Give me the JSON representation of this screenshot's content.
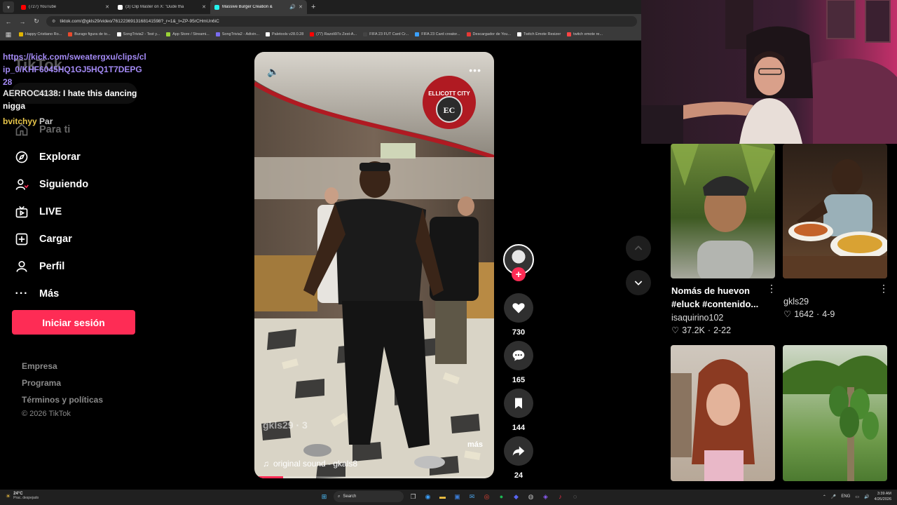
{
  "browser": {
    "tabs": [
      {
        "label": "(727) YouTube",
        "color": "#ff0000",
        "active": false
      },
      {
        "label": "(3) Clip Master on X: \"Dude tha",
        "color": "#ffffff",
        "active": false
      },
      {
        "label": "Massive Burger Creation &",
        "color": "#25f4ee",
        "active": true
      }
    ],
    "new_tab": "+",
    "url": "tiktok.com/@gkls29/video/7612236913168141598?_r=1&_t=ZP-95rCHmUn6iC",
    "bookmarks": [
      {
        "label": "Happy Cristiano Ro...",
        "color": "#e0b400"
      },
      {
        "label": "Burago figura de to...",
        "color": "#e84a2c"
      },
      {
        "label": "SongTrivia2 - Test y...",
        "color": "#ffffff"
      },
      {
        "label": "App Store / Streami...",
        "color": "#9ad336"
      },
      {
        "label": "SongTrivia2 - Adivin...",
        "color": "#7a6cf0"
      },
      {
        "label": "Paletools v28.0.28",
        "color": "#ffffff"
      },
      {
        "label": "(77) Razoli97s Zest-A...",
        "color": "#ff0000"
      },
      {
        "label": "FIFA 23 FUT Card Cr...",
        "color": "#444444"
      },
      {
        "label": "FIFA 23 Card creator...",
        "color": "#3aa0ff"
      },
      {
        "label": "Descargador de You...",
        "color": "#e53935"
      },
      {
        "label": "Twitch Emote Resizer",
        "color": "#ffffff"
      },
      {
        "label": "twitch emote re...",
        "color": "#ff4444"
      }
    ]
  },
  "chat": {
    "link": "https://kick.com/sweatergxu/clips/clip_0/KHF6045HQ1GJ5HQ1T7DEPG28",
    "user1": "AERROC4138",
    "msg1": ": I hate this dancing nigga",
    "user2": "bvitchyy",
    "msg2": "Par"
  },
  "tiktok": {
    "logo": "TikTok",
    "search_placeholder": "Buscar",
    "nav": [
      {
        "label": "Para ti",
        "icon": "home-icon",
        "faded": true
      },
      {
        "label": "Explorar",
        "icon": "compass-icon",
        "faded": false
      },
      {
        "label": "Siguiendo",
        "icon": "following-icon",
        "faded": false
      },
      {
        "label": "LIVE",
        "icon": "live-icon",
        "faded": false
      },
      {
        "label": "Cargar",
        "icon": "upload-icon",
        "faded": false
      },
      {
        "label": "Perfil",
        "icon": "profile-icon",
        "faded": false
      },
      {
        "label": "Más",
        "icon": "more-dots-icon",
        "faded": false
      }
    ],
    "login_button": "Iniciar sesión",
    "footer": {
      "links": [
        "Empresa",
        "Programa",
        "Términos y políticas"
      ],
      "copyright": "© 2026 TikTok"
    },
    "video": {
      "author": "gkls29",
      "author_suffix": "· 3",
      "more": "más",
      "sound": "original sound - gkals8",
      "progress": 0.12,
      "sign_text": "ELLICOTT CITY",
      "sign_badge": "EC"
    },
    "actions": {
      "likes": "730",
      "comments": "165",
      "saves": "144",
      "shares": "24"
    },
    "recommended": [
      {
        "title": "Nomás de huevon #eluck #contenido...",
        "author": "isaquirino102",
        "likes": "37.2K",
        "date": "2-22"
      },
      {
        "title": "",
        "author": "gkls29",
        "likes": "1642",
        "date": "4-9"
      },
      {
        "title": "",
        "author": "",
        "likes": "",
        "date": ""
      },
      {
        "title": "",
        "author": "",
        "likes": "",
        "date": ""
      }
    ],
    "accent": "#fe2c55"
  },
  "taskbar": {
    "temp": "24°C",
    "weather": "Prac. despejado",
    "search": "Search",
    "lang": "ENG",
    "time": "3:39 AM",
    "date": "4/26/2026"
  }
}
